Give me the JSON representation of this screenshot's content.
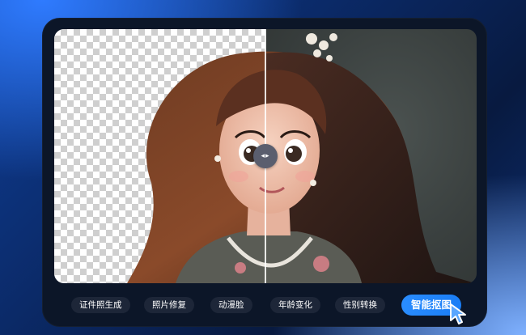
{
  "toolbar": {
    "items": [
      {
        "label": "证件照生成",
        "active": false
      },
      {
        "label": "照片修复",
        "active": false
      },
      {
        "label": "动漫脸",
        "active": false
      },
      {
        "label": "年龄变化",
        "active": false
      },
      {
        "label": "性别转换",
        "active": false
      },
      {
        "label": "智能抠图",
        "active": true
      }
    ]
  },
  "compare": {
    "handle_icon": "compare-arrows-icon",
    "handle_glyph": "◂▸",
    "left_state": "transparent-background",
    "right_state": "original-background"
  },
  "colors": {
    "accent": "#1a7df5",
    "panel": "#0c1628",
    "chip": "#1d2638"
  }
}
